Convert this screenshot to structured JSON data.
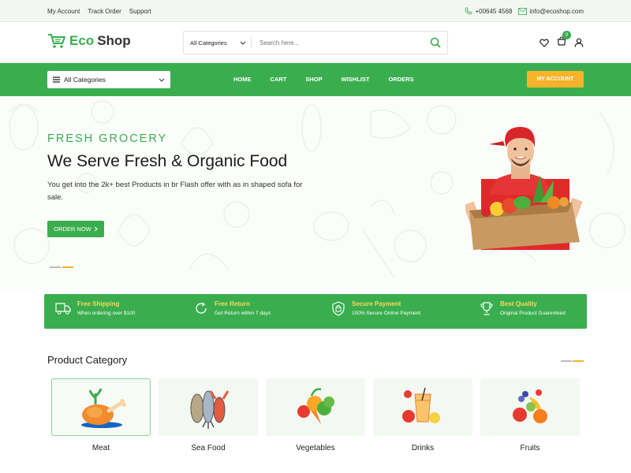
{
  "topbar": {
    "links": [
      "My Account",
      "Track Order",
      "Support"
    ],
    "phone": "+00645 4568",
    "email": "info@ecoshop.com"
  },
  "header": {
    "logo_part1": "Eco",
    "logo_part2": "Shop",
    "search_category": "All Categories",
    "search_placeholder": "Search here...",
    "cart_count": "0"
  },
  "nav": {
    "all_categories": "All Categories",
    "menu": [
      "HOME",
      "CART",
      "SHOP",
      "WISHLIST",
      "ORDERS"
    ],
    "my_account": "MY ACCOUNT"
  },
  "hero": {
    "subtitle": "FRESH GROCERY",
    "title": "We Serve Fresh & Organic Food",
    "description": "You get into the 2k+ best Products in br Flash offer with as in shaped sofa for sale.",
    "cta": "ORDER NOW"
  },
  "features": [
    {
      "title": "Free Shipping",
      "subtitle": "When ordering over $100",
      "icon": "truck-icon"
    },
    {
      "title": "Free Return",
      "subtitle": "Get Return within 7 days",
      "icon": "refresh-icon"
    },
    {
      "title": "Secure Payment",
      "subtitle": "100% Secure Online Payment",
      "icon": "lock-icon"
    },
    {
      "title": "Best Quality",
      "subtitle": "Original Product Guarenteed",
      "icon": "trophy-icon"
    }
  ],
  "categories": {
    "title": "Product Category",
    "items": [
      "Meat",
      "Sea Food",
      "Vegetables",
      "Drinks",
      "Fruits"
    ]
  },
  "colors": {
    "brand_green": "#3aae4e",
    "accent_orange": "#f7b32b",
    "feature_title_yellow": "#ffd85a"
  }
}
